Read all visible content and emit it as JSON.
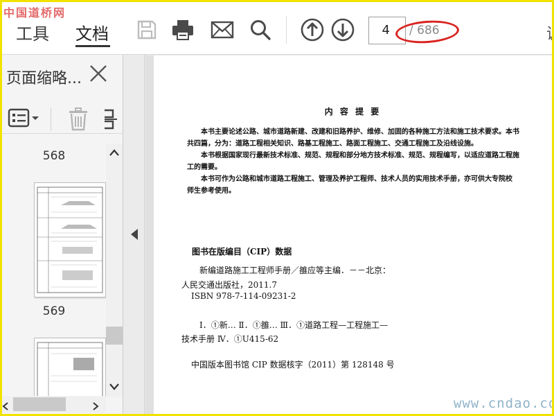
{
  "watermark_top": "中国道桥网",
  "watermark_bottom": "www.cndao.com",
  "toolbar": {
    "tab_tools": "工具",
    "tab_document": "文档",
    "current_page": "4",
    "total_pages": "/ 686",
    "overflow": "调",
    "icons": [
      "save-icon",
      "print-icon",
      "email-icon",
      "search-icon",
      "page-up-icon",
      "page-down-icon"
    ]
  },
  "side_panel": {
    "title": "页面缩略...",
    "pages": [
      {
        "label": "568"
      },
      {
        "label": "569"
      }
    ]
  },
  "document": {
    "summary_title": "内 容 提 要",
    "summary_lines": [
      "本书主要论述公路、城市道路新建、改建和旧路养护、维修、加固的各种施工方法和施工技术要求。本书",
      "共四篇，分为：道路工程相关知识、路基工程施工、路面工程施工、交通工程施工及沿线设施。",
      "本书根据国家现行最新技术标准、规范、规程和部分地方技术标准、规范、规程编写，以适应道路工程施",
      "工的需要。",
      "本书可作为公路和城市道路工程施工、管理及养护工程师、技术人员的实用技术手册，亦可供大专院校",
      "师生参考使用。"
    ],
    "cip_heading": "图书在版编目（CIP）数据",
    "cip_lines": [
      "新编道路施工工程师手册／雒应等主编．－－北京：",
      "人民交通出版社，2011.7",
      "ISBN  978-7-114-09231-2",
      "Ⅰ．①新…  Ⅱ．①雒…  Ⅲ．①道路工程—工程施工—",
      "技术手册  Ⅳ．①U415-62",
      "中国版本图书馆 CIP 数据核字（2011）第 128148 号"
    ]
  },
  "colors": {
    "annotation": "#d9231f",
    "frame": "#f2e200",
    "icon_gray": "#b5b5b5",
    "icon_dark": "#4a4a4a"
  }
}
